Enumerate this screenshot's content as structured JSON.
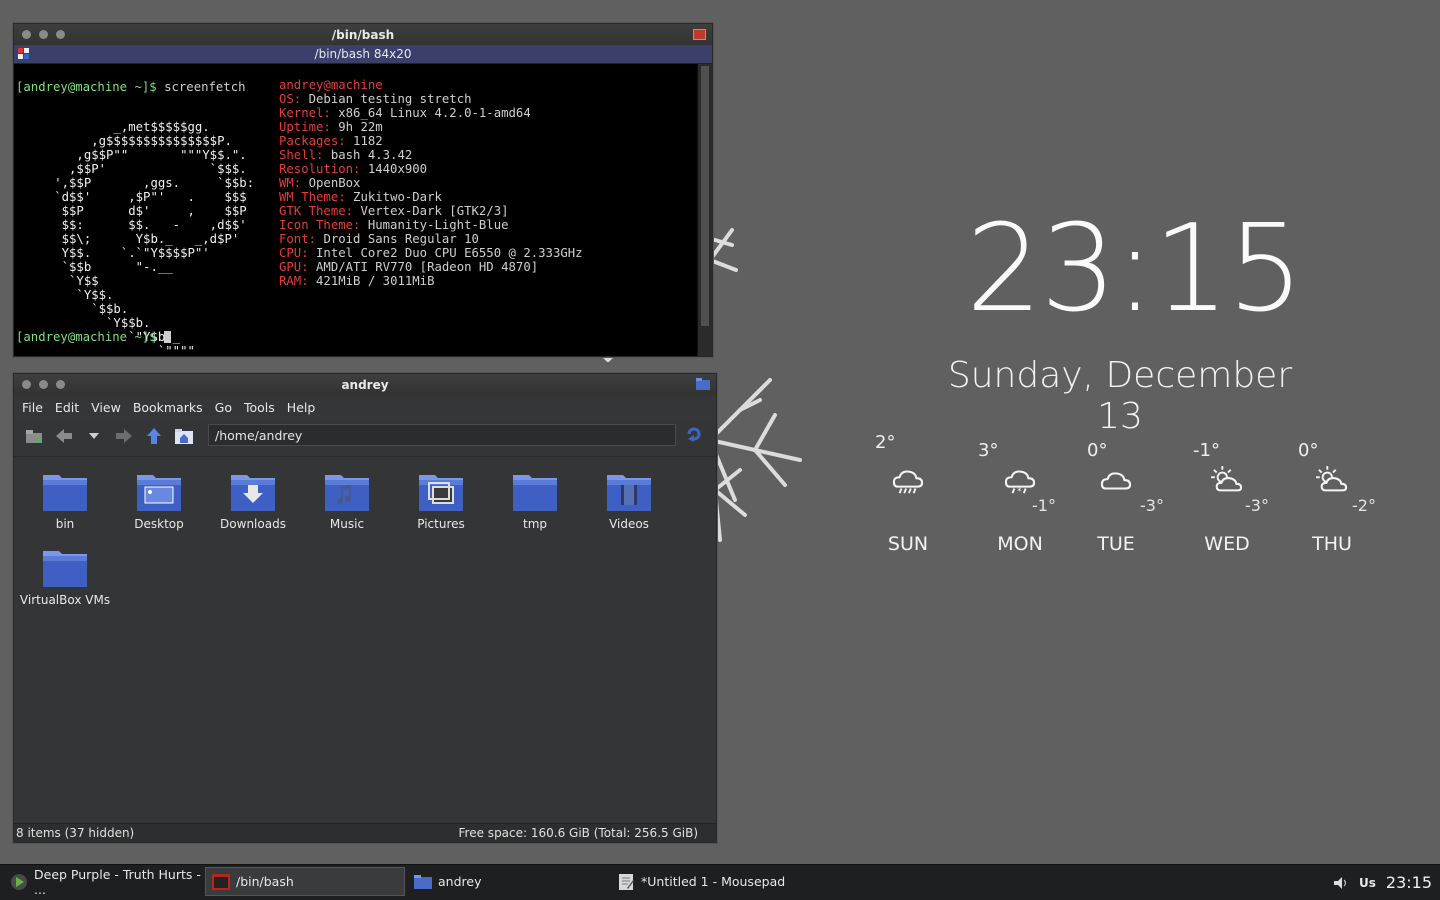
{
  "terminal": {
    "window_title": "/bin/bash",
    "tab_title": "/bin/bash 84x20",
    "prompt_line": "[andrey@machine ~]$ screenfetch",
    "final_prompt": "[andrey@machine ~]$ ",
    "user_host": "andrey@machine",
    "info": [
      {
        "label": "OS:",
        "value": "Debian testing stretch"
      },
      {
        "label": "Kernel:",
        "value": "x86_64 Linux 4.2.0-1-amd64"
      },
      {
        "label": "Uptime:",
        "value": "9h 22m"
      },
      {
        "label": "Packages:",
        "value": "1182"
      },
      {
        "label": "Shell:",
        "value": "bash 4.3.42"
      },
      {
        "label": "Resolution:",
        "value": "1440x900"
      },
      {
        "label": "WM:",
        "value": "OpenBox"
      },
      {
        "label": "WM Theme:",
        "value": "Zukitwo-Dark"
      },
      {
        "label": "GTK Theme:",
        "value": "Vertex-Dark [GTK2/3]"
      },
      {
        "label": "Icon Theme:",
        "value": "Humanity-Light-Blue"
      },
      {
        "label": "Font:",
        "value": "Droid Sans Regular 10"
      },
      {
        "label": "CPU:",
        "value": "Intel Core2 Duo CPU E6550 @ 2.333GHz"
      },
      {
        "label": "GPU:",
        "value": "AMD/ATI RV770 [Radeon HD 4870]"
      },
      {
        "label": "RAM:",
        "value": "421MiB / 3011MiB"
      }
    ],
    "ascii_logo": "           _,met$$$$$gg.\n        ,g$$$$$$$$$$$$$$$P.\n      ,g$$P\"\"       \"\"\"Y$$.\".\n     ,$$P'              `$$$.\n   ',$$P       ,ggs.     `$$b:\n   `d$$'     ,$P\"'   .    $$$\n    $$P      d$'     ,    $$P\n    $$:      $$.   -    ,d$$'\n    $$\\;      Y$b._   _,d$P'\n    Y$$.    `.`\"Y$$$$P\"'\n    `$$b      \"-.__\n     `Y$$\n      `Y$$.\n        `$$b.\n          `Y$$b.\n             `\"Y$b._\n                 `\"\"\"\""
  },
  "file_manager": {
    "window_title": "andrey",
    "menu": [
      "File",
      "Edit",
      "View",
      "Bookmarks",
      "Go",
      "Tools",
      "Help"
    ],
    "path": "/home/andrey",
    "items": [
      {
        "name": "bin",
        "icon": "folder-icon"
      },
      {
        "name": "Desktop",
        "icon": "desktop-folder-icon"
      },
      {
        "name": "Downloads",
        "icon": "downloads-folder-icon"
      },
      {
        "name": "Music",
        "icon": "music-folder-icon"
      },
      {
        "name": "Pictures",
        "icon": "pictures-folder-icon"
      },
      {
        "name": "tmp",
        "icon": "folder-icon"
      },
      {
        "name": "Videos",
        "icon": "videos-folder-icon"
      },
      {
        "name": "VirtualBox VMs",
        "icon": "folder-icon"
      }
    ],
    "status_left": "8 items (37 hidden)",
    "status_right": "Free space: 160.6 GiB (Total: 256.5 GiB)"
  },
  "desktop_widget": {
    "time": "23:15",
    "date": "Sunday, December 13",
    "forecast": [
      {
        "day": "SUN",
        "high": "2°",
        "low": "",
        "icon": "rain-icon"
      },
      {
        "day": "MON",
        "high": "3°",
        "low": "-1°",
        "icon": "snow-rain-icon"
      },
      {
        "day": "TUE",
        "high": "0°",
        "low": "-3°",
        "icon": "cloud-icon"
      },
      {
        "day": "WED",
        "high": "-1°",
        "low": "-3°",
        "icon": "partly-sunny-icon"
      },
      {
        "day": "THU",
        "high": "0°",
        "low": "-2°",
        "icon": "partly-sunny-icon"
      }
    ]
  },
  "taskbar": {
    "tasks": [
      {
        "label": "Deep Purple - Truth Hurts - ...",
        "icon": "media-player-icon"
      },
      {
        "label": "/bin/bash",
        "icon": "terminal-icon",
        "active": true
      },
      {
        "label": "andrey",
        "icon": "folder-icon"
      },
      {
        "label": "*Untitled 1 - Mousepad",
        "icon": "text-editor-icon"
      }
    ],
    "keyboard_layout": "Us",
    "clock": "23:15"
  }
}
